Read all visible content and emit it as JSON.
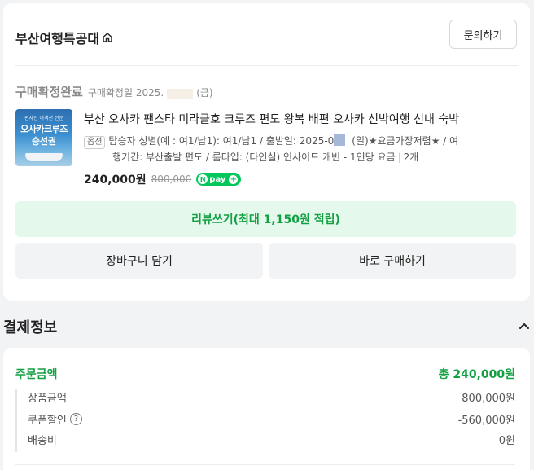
{
  "order": {
    "store_name": "부산여행특공대",
    "inquiry_button": "문의하기",
    "status": "구매확정완료",
    "confirm_date_prefix": "구매확정일 2025.",
    "confirm_date_suffix": "(금)",
    "thumbnail": {
      "caption_small": "편사신 여객선 전문",
      "caption_line1": "오사카크루즈",
      "caption_line2": "승선권"
    },
    "product_title": "부산 오사카 팬스타 미라클호 크루즈 편도 왕복 배편 오사카 선박여행 선내 숙박",
    "option_badge": "옵션",
    "option_line1_a": "탑승자 성별(예 : 여1/남1): 여1/남1 / 출발일: 2025-0",
    "option_line1_b": "(일)★요금가장저렴★ / 여",
    "option_line2": "행기간: 부산출발 편도 / 룸타입: (다인실) 인사이드 캐빈 - 1인당 요금",
    "quantity": "2개",
    "price": "240,000원",
    "original_price": "800,000",
    "npay_text": "pay",
    "review_button": "리뷰쓰기(최대 1,150원 적립)",
    "cart_button": "장바구니 담기",
    "buy_button": "바로 구매하기"
  },
  "payment": {
    "section_title": "결제정보",
    "order_amount_label": "주문금액",
    "order_amount_total": "총 240,000원",
    "rows": [
      {
        "label": "상품금액",
        "value": "800,000원"
      },
      {
        "label": "쿠폰할인",
        "value": "-560,000원"
      },
      {
        "label": "배송비",
        "value": "0원"
      }
    ]
  },
  "colors": {
    "accent_green": "#12a043",
    "npay_green": "#03c75a",
    "review_bg": "#e5f8ec"
  }
}
